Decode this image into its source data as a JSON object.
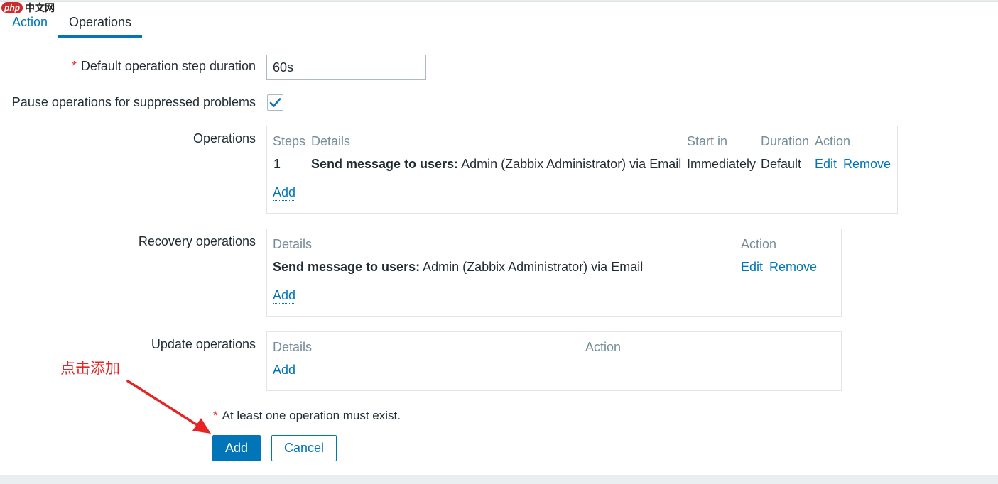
{
  "watermark": {
    "logo": "php",
    "text": "中文网"
  },
  "tabs": [
    {
      "label": "Action",
      "active": false
    },
    {
      "label": "Operations",
      "active": true
    }
  ],
  "form": {
    "step_duration": {
      "label": "Default operation step duration",
      "value": "60s",
      "required": "*"
    },
    "pause_suppressed": {
      "label": "Pause operations for suppressed problems",
      "checked": true
    },
    "operations": {
      "label": "Operations",
      "headers": [
        "Steps",
        "Details",
        "Start in",
        "Duration",
        "Action"
      ],
      "rows": [
        {
          "steps": "1",
          "details_bold": "Send message to users:",
          "details_rest": " Admin (Zabbix Administrator) via Email",
          "start_in": "Immediately",
          "duration": "Default",
          "edit": "Edit",
          "remove": "Remove"
        }
      ],
      "add": "Add"
    },
    "recovery_operations": {
      "label": "Recovery operations",
      "headers": [
        "Details",
        "Action"
      ],
      "rows": [
        {
          "details_bold": "Send message to users:",
          "details_rest": " Admin (Zabbix Administrator) via Email",
          "edit": "Edit",
          "remove": "Remove"
        }
      ],
      "add": "Add"
    },
    "update_operations": {
      "label": "Update operations",
      "headers": [
        "Details",
        "Action"
      ],
      "add": "Add"
    },
    "note": "At least one operation must exist.",
    "note_marker": "*",
    "add_button": "Add",
    "cancel_button": "Cancel"
  },
  "annotation": {
    "text": "点击添加"
  },
  "colors": {
    "accent": "#0275b8",
    "required": "#e33734",
    "annotation": "#e52424",
    "header_text": "#768d99"
  }
}
